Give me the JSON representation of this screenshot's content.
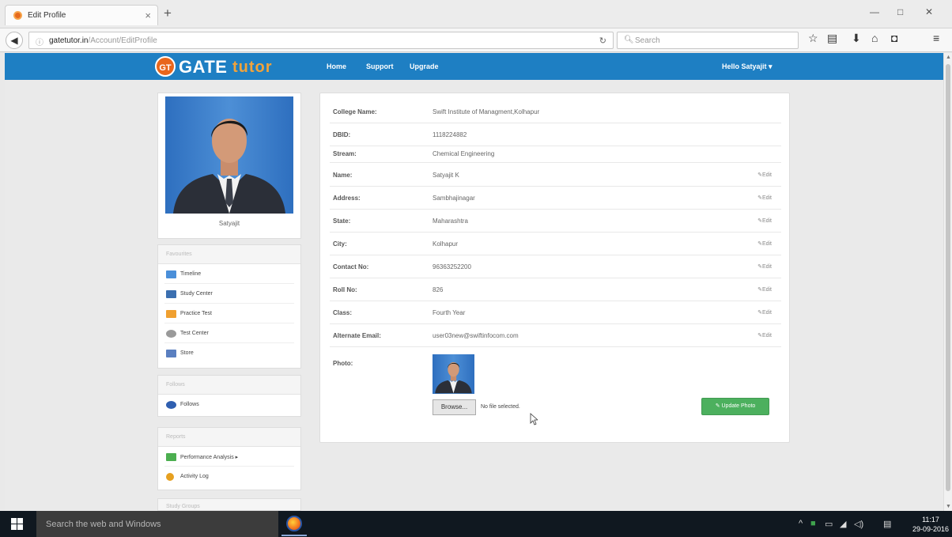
{
  "browser": {
    "tab_title": "Edit Profile",
    "url_domain": "gatetutor.in",
    "url_path": "/Account/EditProfile",
    "search_placeholder": "Search"
  },
  "header": {
    "brand_prefix": "GT",
    "brand_main": "GATE",
    "brand_accent": "tutor",
    "nav": [
      "Home",
      "Support",
      "Upgrade"
    ],
    "greeting": "Hello Satyajit ▾"
  },
  "sidebar": {
    "profile_name": "Satyajit",
    "favourites": {
      "heading": "Favourites",
      "items": [
        {
          "label": "Timeline",
          "color": "#4a8fd9"
        },
        {
          "label": "Study Center",
          "color": "#3b6fb0"
        },
        {
          "label": "Practice Test",
          "color": "#f0a030"
        },
        {
          "label": "Test Center",
          "color": "#9a9a9a"
        },
        {
          "label": "Store",
          "color": "#5a7fc0"
        }
      ]
    },
    "follows": {
      "heading": "Follows",
      "items": [
        {
          "label": "Follows",
          "color": "#2f5fb0"
        }
      ]
    },
    "reports": {
      "heading": "Reports",
      "items": [
        {
          "label": "Performance Analysis ▸",
          "color": "#4caf50"
        },
        {
          "label": "Activity Log",
          "color": "#e6a020"
        }
      ]
    },
    "next_heading": "Study Groups"
  },
  "profile": {
    "rows": [
      {
        "label": "College Name:",
        "value": "Swift Institute of Managment,Kolhapur",
        "editable": false
      },
      {
        "label": "DBID:",
        "value": "1118224882",
        "editable": false
      },
      {
        "label": "Stream:",
        "value": "Chemical Engineering",
        "editable": false
      },
      {
        "label": "Name:",
        "value": "Satyajit K",
        "editable": true
      },
      {
        "label": "Address:",
        "value": "Sambhajinagar",
        "editable": true
      },
      {
        "label": "State:",
        "value": "Maharashtra",
        "editable": true
      },
      {
        "label": "City:",
        "value": "Kolhapur",
        "editable": true
      },
      {
        "label": "Contact No:",
        "value": "96363252200",
        "editable": true
      },
      {
        "label": "Roll No:",
        "value": "826",
        "editable": true
      },
      {
        "label": "Class:",
        "value": "Fourth Year",
        "editable": true
      },
      {
        "label": "Alternate Email:",
        "value": "user03new@swiftinfocom.com",
        "editable": true
      }
    ],
    "edit_label": "Edit",
    "photo_label": "Photo:",
    "browse_label": "Browse...",
    "no_file_text": "No file selected.",
    "update_photo_label": "Update Photo"
  },
  "taskbar": {
    "search_placeholder": "Search the web and Windows",
    "time": "11:17",
    "date": "29-09-2016"
  },
  "colors": {
    "header_blue": "#1e7fc3",
    "accent_orange": "#f2a33a",
    "update_green": "#4cb05e"
  }
}
